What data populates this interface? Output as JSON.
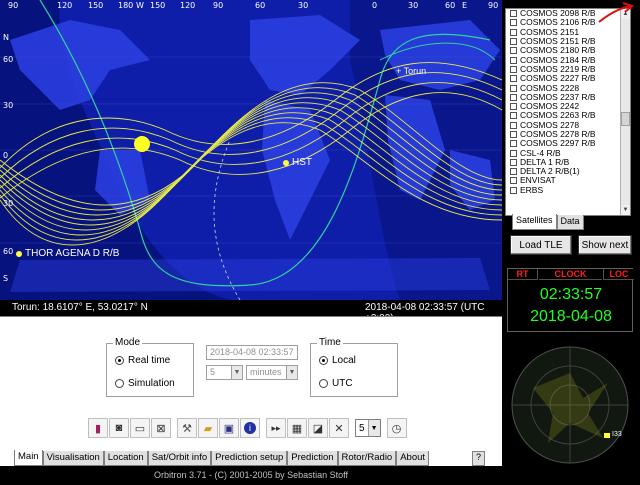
{
  "map": {
    "lon_labels": [
      "90",
      "120",
      "150",
      "180",
      "W",
      "150",
      "120",
      "90",
      "60",
      "30",
      "0",
      "30",
      "60",
      "E",
      "90"
    ],
    "lat_labels": [
      "N",
      "60",
      "30",
      "0",
      "30",
      "60",
      "S"
    ],
    "observer_label": "+ Torun",
    "satellites": [
      {
        "name": "HST"
      },
      {
        "name": "THOR AGENA D R/B"
      }
    ]
  },
  "status": {
    "location": "Torun: 18.6107° E, 53.0217° N",
    "datetime": "2018-04-08 02:33:57 (UTC +3:00)"
  },
  "mode": {
    "title": "Mode",
    "options": [
      {
        "label": "Real time",
        "selected": true
      },
      {
        "label": "Simulation",
        "selected": false
      }
    ]
  },
  "sim": {
    "datetime_value": "2018-04-08 02:33:57",
    "step_value": "5",
    "unit_value": "minutes"
  },
  "time": {
    "title": "Time",
    "options": [
      {
        "label": "Local",
        "selected": true
      },
      {
        "label": "UTC",
        "selected": false
      }
    ]
  },
  "toolbar": {
    "speed_value": "5",
    "icons": [
      "book-icon",
      "camera-icon",
      "minimize-window-icon",
      "close-window-icon",
      "tools-icon",
      "folder-open-icon",
      "save-icon",
      "info-icon",
      "forward-icon",
      "grid-icon",
      "window-icon",
      "expand-icon",
      "shrink-icon",
      "clock-icon"
    ]
  },
  "tabs": [
    "Main",
    "Visualisation",
    "Location",
    "Sat/Orbit info",
    "Prediction setup",
    "Prediction",
    "Rotor/Radio",
    "About"
  ],
  "help_tab": "?",
  "satellite_list": [
    "COSMOS 2098 R/B",
    "COSMOS 2106 R/B",
    "COSMOS 2151",
    "COSMOS 2151 R/B",
    "COSMOS 2180 R/B",
    "COSMOS 2184 R/B",
    "COSMOS 2219 R/B",
    "COSMOS 2227 R/B",
    "COSMOS 2228",
    "COSMOS 2237 R/B",
    "COSMOS 2242",
    "COSMOS 2263 R/B",
    "COSMOS 2278",
    "COSMOS 2278 R/B",
    "COSMOS 2297 R/B",
    "CSL-4 R/B",
    "DELTA 1 R/B",
    "DELTA 2 R/B(1)",
    "ENVISAT",
    "ERBS"
  ],
  "list_tabs": [
    "Satellites",
    "Data"
  ],
  "buttons": {
    "load_tle": "Load TLE",
    "show_next": "Show next"
  },
  "clock": {
    "rt_label": "RT",
    "clock_label": "CLOCK",
    "loc_label": "LOC",
    "time": "02:33:57",
    "date": "2018-04-08"
  },
  "radar": {
    "sat_label": "I33"
  },
  "footer": "Orbitron 3.71 - (C) 2001-2005 by Sebastian Stoff",
  "colors": {
    "ocean": "#0e1ea8",
    "land": "#2436d6",
    "night": "#000a5a",
    "track": "#ffff40",
    "clock_text": "#20ff20",
    "clock_header": "#ff2020"
  }
}
